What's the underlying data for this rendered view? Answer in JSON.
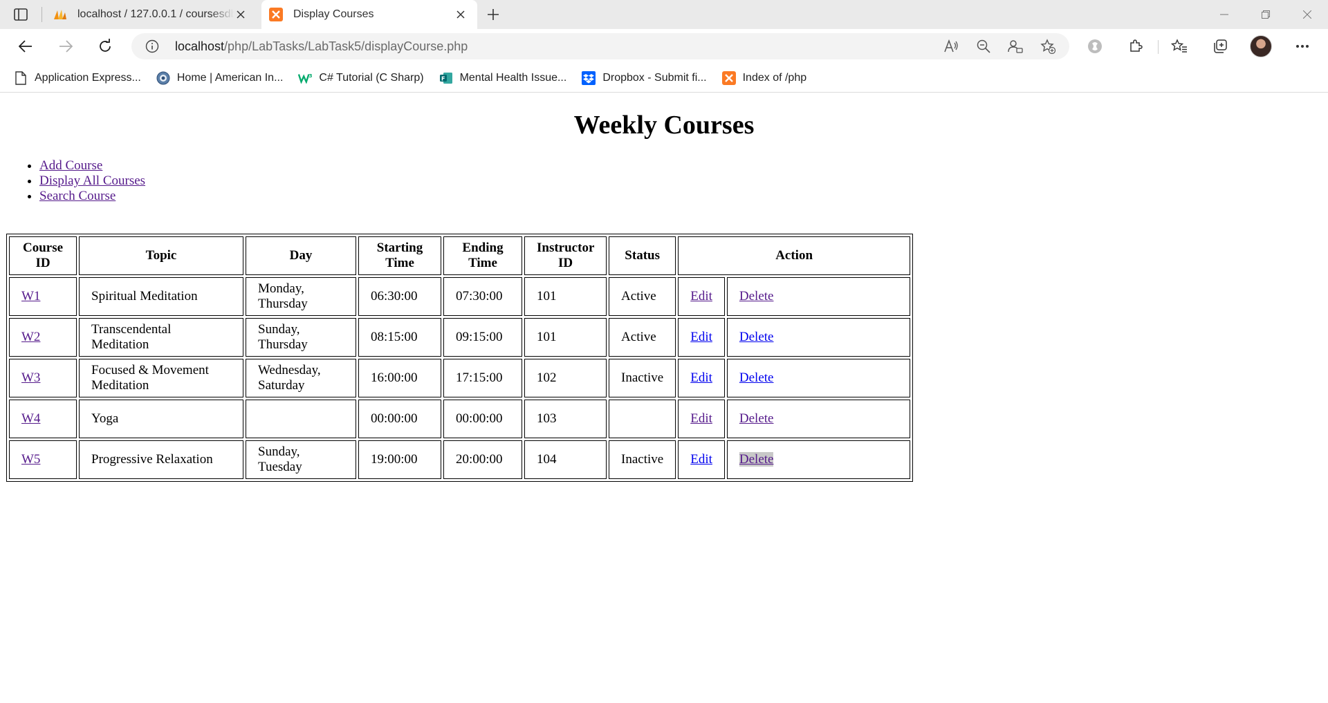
{
  "browser": {
    "tabs": [
      {
        "title": "localhost / 127.0.0.1 / coursesdb",
        "icon": "phpmyadmin-icon",
        "active": false
      },
      {
        "title": "Display Courses",
        "icon": "xampp-icon",
        "active": true
      }
    ],
    "address": {
      "host": "localhost",
      "path": "/php/LabTasks/LabTask5/displayCourse.php"
    },
    "bookmarks": [
      {
        "label": "Application Express...",
        "icon": "page-icon"
      },
      {
        "label": "Home | American In...",
        "icon": "globe-icon"
      },
      {
        "label": "C# Tutorial (C Sharp)",
        "icon": "w3schools-icon"
      },
      {
        "label": "Mental Health Issue...",
        "icon": "forms-icon"
      },
      {
        "label": "Dropbox - Submit fi...",
        "icon": "dropbox-icon"
      },
      {
        "label": "Index of /php",
        "icon": "xampp-icon"
      }
    ]
  },
  "page": {
    "title": "Weekly Courses",
    "nav": [
      "Add Course",
      "Display All Courses",
      "Search Course"
    ],
    "table": {
      "headers": [
        "Course ID",
        "Topic",
        "Day",
        "Starting Time",
        "Ending Time",
        "Instructor ID",
        "Status",
        "Action"
      ],
      "action_labels": {
        "edit": "Edit",
        "delete": "Delete"
      },
      "rows": [
        {
          "id": "W1",
          "topic": "Spiritual Meditation",
          "day": "Monday, Thursday",
          "start": "06:30:00",
          "end": "07:30:00",
          "instructor": "101",
          "status": "Active"
        },
        {
          "id": "W2",
          "topic": "Transcendental Meditation",
          "day": "Sunday, Thursday",
          "start": "08:15:00",
          "end": "09:15:00",
          "instructor": "101",
          "status": "Active"
        },
        {
          "id": "W3",
          "topic": "Focused & Movement Meditation",
          "day": "Wednesday, Saturday",
          "start": "16:00:00",
          "end": "17:15:00",
          "instructor": "102",
          "status": "Inactive"
        },
        {
          "id": "W4",
          "topic": "Yoga",
          "day": "",
          "start": "00:00:00",
          "end": "00:00:00",
          "instructor": "103",
          "status": ""
        },
        {
          "id": "W5",
          "topic": "Progressive Relaxation",
          "day": "Sunday, Tuesday",
          "start": "19:00:00",
          "end": "20:00:00",
          "instructor": "104",
          "status": "Inactive"
        }
      ]
    }
  }
}
